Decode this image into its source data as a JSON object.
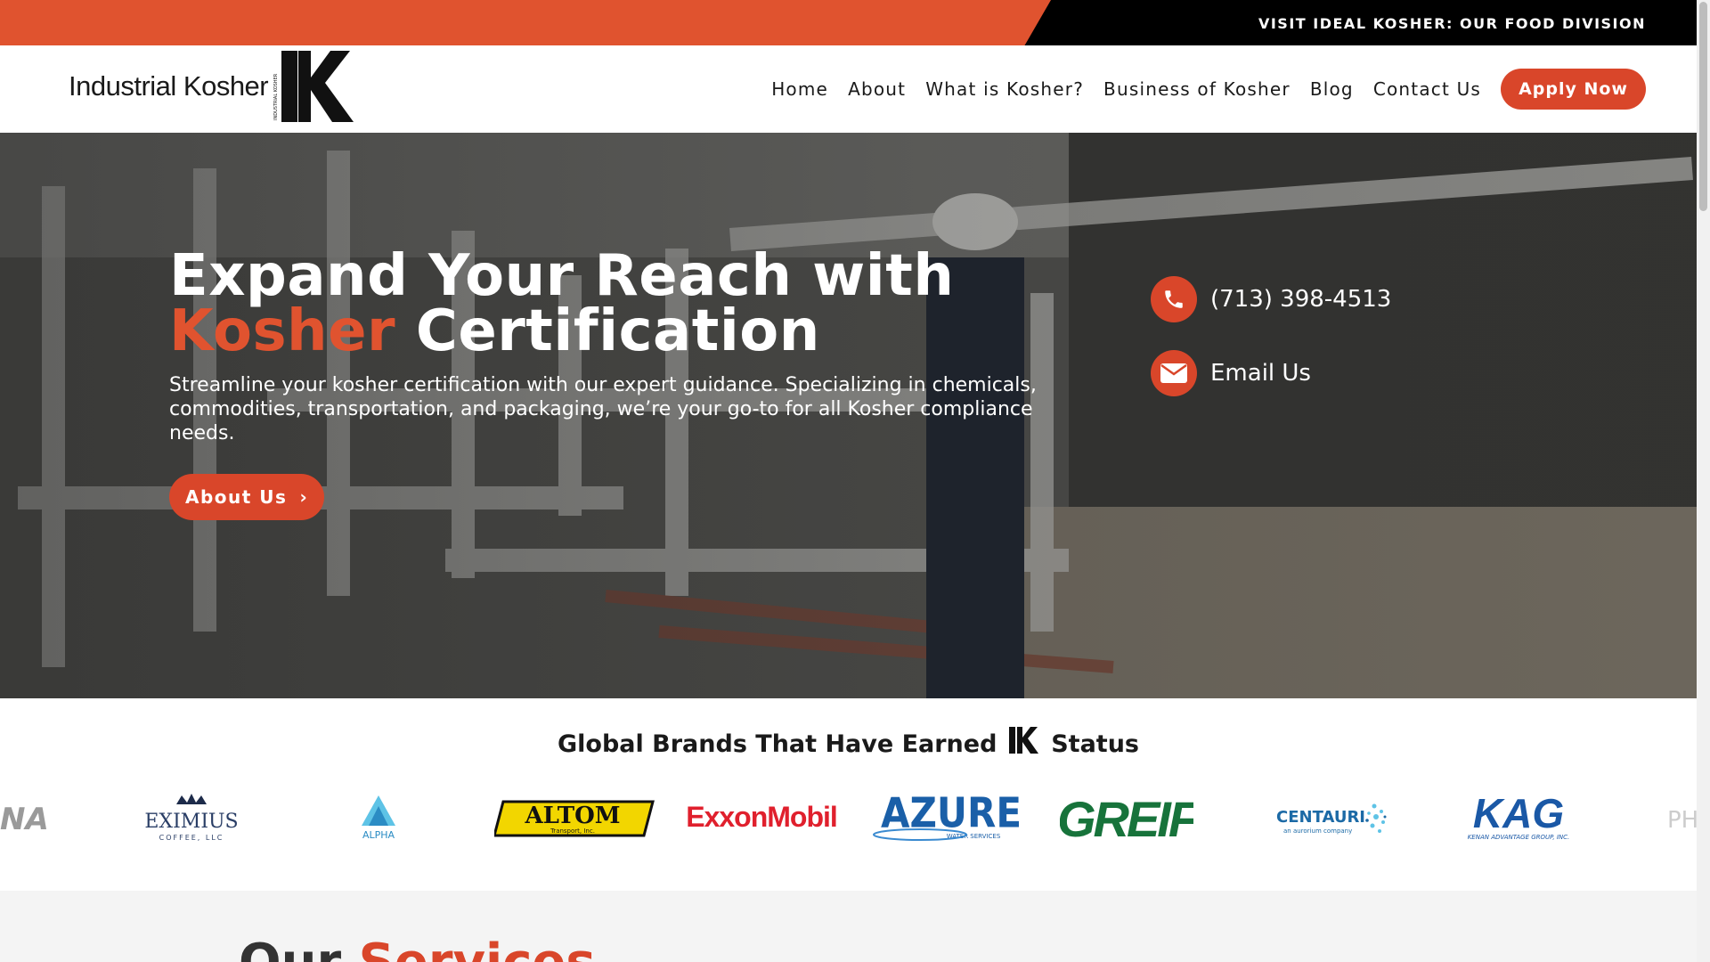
{
  "topbar": {
    "link": "VISIT IDEAL KOSHER: OUR FOOD DIVISION"
  },
  "header": {
    "logo_text": "Industrial Kosher",
    "logo_mark_small": "INDUSTRIAL KOSHER",
    "nav": [
      "Home",
      "About",
      "What is Kosher?",
      "Business of Kosher",
      "Blog",
      "Contact Us"
    ],
    "apply_label": "Apply Now"
  },
  "hero": {
    "title_line1": "Expand Your Reach with",
    "title_accent": "Kosher",
    "title_rest": " Certification",
    "subtitle": "Streamline your kosher certification with our expert guidance. Specializing in chemicals, commodities, transportation, and packaging, we’re your go-to for all Kosher compliance needs.",
    "button_label": "About Us",
    "phone": "(713) 398-4513",
    "email_label": "Email Us"
  },
  "brands": {
    "title_before": "Global Brands That Have Earned",
    "title_after": "Status",
    "logos": [
      {
        "name": "NA",
        "color": "#9a9a9a"
      },
      {
        "name": "EXIMIUS",
        "sub": "COFFEE, LLC",
        "color": "#2a3e66"
      },
      {
        "name": "ALPHA",
        "color": "#2b8cc4"
      },
      {
        "name": "ALTOM",
        "sub": "Transport, Inc.",
        "color": "#f2d600"
      },
      {
        "name": "ExxonMobil",
        "color": "#e0202d"
      },
      {
        "name": "AZURE",
        "sub": "WATER SERVICES",
        "color": "#1a5fa8"
      },
      {
        "name": "GREIF",
        "color": "#17733b"
      },
      {
        "name": "CENTAURI",
        "sub": "an aurorium company",
        "color": "#1c6aa6"
      },
      {
        "name": "KAG",
        "sub": "KENAN ADVANTAGE GROUP, INC.",
        "color": "#1a58a6"
      },
      {
        "name": "PH",
        "color": "#cccccc"
      }
    ]
  },
  "services": {
    "title_plain": "Our",
    "title_accent": "Services"
  },
  "colors": {
    "accent": "#e0532f",
    "button": "#d9462a"
  }
}
